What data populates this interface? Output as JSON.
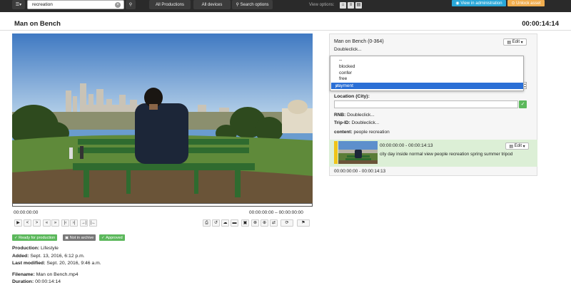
{
  "topbar": {
    "search_value": "recreation",
    "all_productions": "All Productions",
    "all_devices": "All devices",
    "search_options": "Search options",
    "view_options_label": "View options:",
    "view_in_admin": "View in administration",
    "unlock_asset": "Unlock asset"
  },
  "asset": {
    "title": "Man on Bench",
    "duration_header": "00:00:14:14"
  },
  "player": {
    "current_time": "00:00:00:00",
    "range": "00:00:00:00 – 00:00:00:00",
    "controls": [
      "▶",
      "<",
      ">",
      "«",
      "»",
      "|‹",
      "›|",
      "→|",
      "|←"
    ],
    "right_controls": [
      "⎙",
      "↺",
      "☁",
      "▬",
      "▣",
      "⊗",
      "⊕",
      "⇄",
      "⟳",
      "⚑"
    ]
  },
  "badges": {
    "ready": "Ready for production",
    "archive": "Not in archive",
    "approved": "Approved"
  },
  "meta": {
    "production_label": "Production:",
    "production_value": "Lifestyle",
    "added_label": "Added:",
    "added_value": "Sept. 13, 2016, 6:12 p.m.",
    "modified_label": "Last modified:",
    "modified_value": "Sept. 20, 2016, 9:46 a.m.",
    "filename_label": "Filename:",
    "filename_value": "Man on Bench.mp4",
    "duration_label": "Duration:",
    "duration_value": "00:00:14:14"
  },
  "panel": {
    "title": "Man on Bench (0-364)",
    "doubleclick": "Doubleclick...",
    "edit_label": "Edit",
    "dropdown_options": [
      "--",
      "blocked",
      "confer",
      "free"
    ],
    "dropdown_selected": "payment",
    "location_label": "Location (City):",
    "location_value": "",
    "rnb_label": "RNB:",
    "rnb_value": "Doubleclick...",
    "trip_label": "Trip-ID:",
    "trip_value": "Doubleclick...",
    "content_label": "content:",
    "content_value": "people recreation",
    "clip": {
      "timecode": "00:00:00:00 - 00:00:14:13",
      "tags": "city day inside normal view people recreation spring summer tripod",
      "range": "00:00:00:00 - 00:00:14:13",
      "edit_label": "Edit"
    }
  },
  "colors": {
    "topbar": "#2a2a2a",
    "admin": "#29a7d8",
    "unlock": "#f0ad4e",
    "approved_green": "#5cb85c",
    "archive_gray": "#777777",
    "clip_bg": "#dcefd6",
    "dropdown_selected": "#2a6fd6"
  }
}
